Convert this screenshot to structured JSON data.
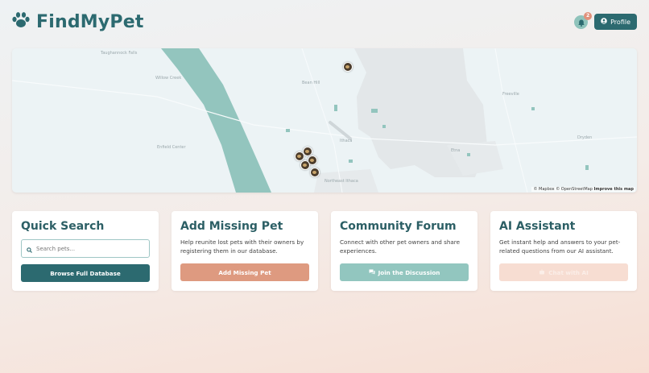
{
  "app": {
    "title": "FindMyPet"
  },
  "header": {
    "notification_count": "2",
    "profile_label": "Profile"
  },
  "map": {
    "place_labels": [
      "Taughannock Falls",
      "Willow Creek",
      "Bean Hill",
      "Ithaca",
      "Freeville",
      "Dryden",
      "Etna",
      "Enfield Center",
      "Northeast Ithaca"
    ],
    "attribution": "© Mapbox © OpenStreetMap",
    "improve_link": "Improve this map",
    "water_color": "#93c5be",
    "urban_color": "#e3e7e9"
  },
  "cards": {
    "quick_search": {
      "title": "Quick Search",
      "search_placeholder": "Search pets...",
      "button_label": "Browse Full Database"
    },
    "add_missing": {
      "title": "Add Missing Pet",
      "description": "Help reunite lost pets with their owners by registering them in our database.",
      "button_label": "Add Missing Pet"
    },
    "forum": {
      "title": "Community Forum",
      "description": "Connect with other pet owners and share experiences.",
      "button_label": "Join the Discussion"
    },
    "ai": {
      "title": "AI Assistant",
      "description": "Get instant help and answers to your pet-related questions from our AI assistant.",
      "button_label": "Chat with AI"
    }
  },
  "colors": {
    "brand": "#2c6a70",
    "coral": "#de9a80",
    "teal": "#92c6bf",
    "disabled": "#f7ddd2"
  },
  "icons": [
    "paw-icon",
    "bell-icon",
    "user-icon",
    "search-icon",
    "comments-icon",
    "robot-icon"
  ]
}
